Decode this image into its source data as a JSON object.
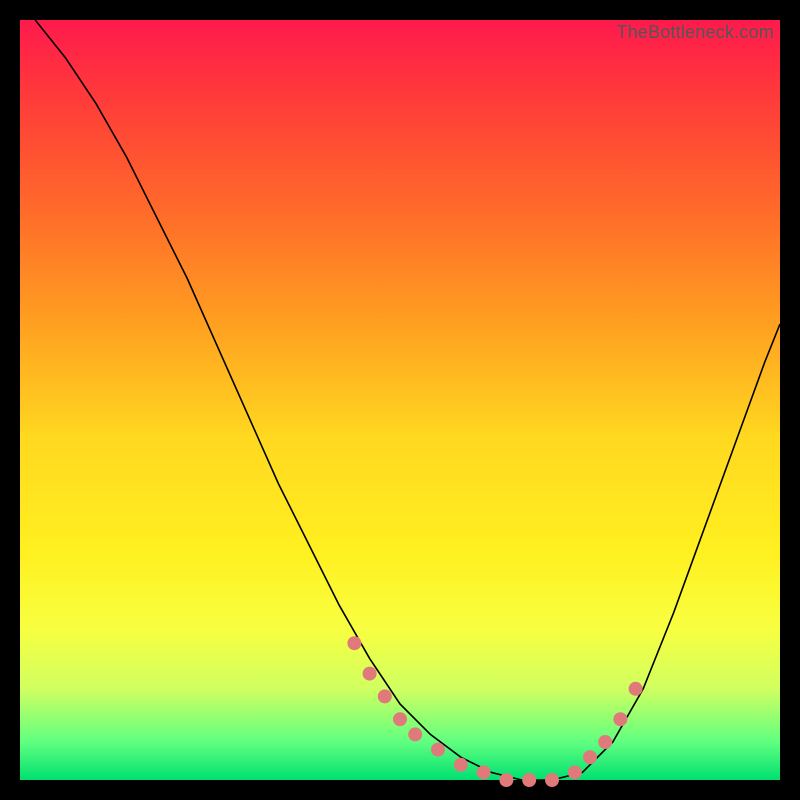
{
  "watermark": "TheBottleneck.com",
  "colors": {
    "frame": "#000000",
    "gradient_top": "#ff1a4d",
    "gradient_bottom": "#00e070",
    "curve": "#000000",
    "dots": "#e07a7a"
  },
  "chart_data": {
    "type": "line",
    "title": "",
    "xlabel": "",
    "ylabel": "",
    "xlim": [
      0,
      100
    ],
    "ylim": [
      0,
      100
    ],
    "grid": false,
    "legend": false,
    "series": [
      {
        "name": "curve",
        "x": [
          2,
          6,
          10,
          14,
          18,
          22,
          26,
          30,
          34,
          38,
          42,
          46,
          50,
          54,
          58,
          62,
          66,
          70,
          74,
          78,
          82,
          86,
          90,
          94,
          98,
          100
        ],
        "y": [
          100,
          95,
          89,
          82,
          74,
          66,
          57,
          48,
          39,
          31,
          23,
          16,
          10,
          6,
          3,
          1,
          0,
          0,
          1,
          5,
          12,
          22,
          33,
          44,
          55,
          60
        ]
      }
    ],
    "highlight_points": {
      "name": "dots",
      "x": [
        44,
        46,
        48,
        50,
        52,
        55,
        58,
        61,
        64,
        67,
        70,
        73,
        75,
        77,
        79,
        81
      ],
      "y": [
        18,
        14,
        11,
        8,
        6,
        4,
        2,
        1,
        0,
        0,
        0,
        1,
        3,
        5,
        8,
        12
      ]
    }
  }
}
